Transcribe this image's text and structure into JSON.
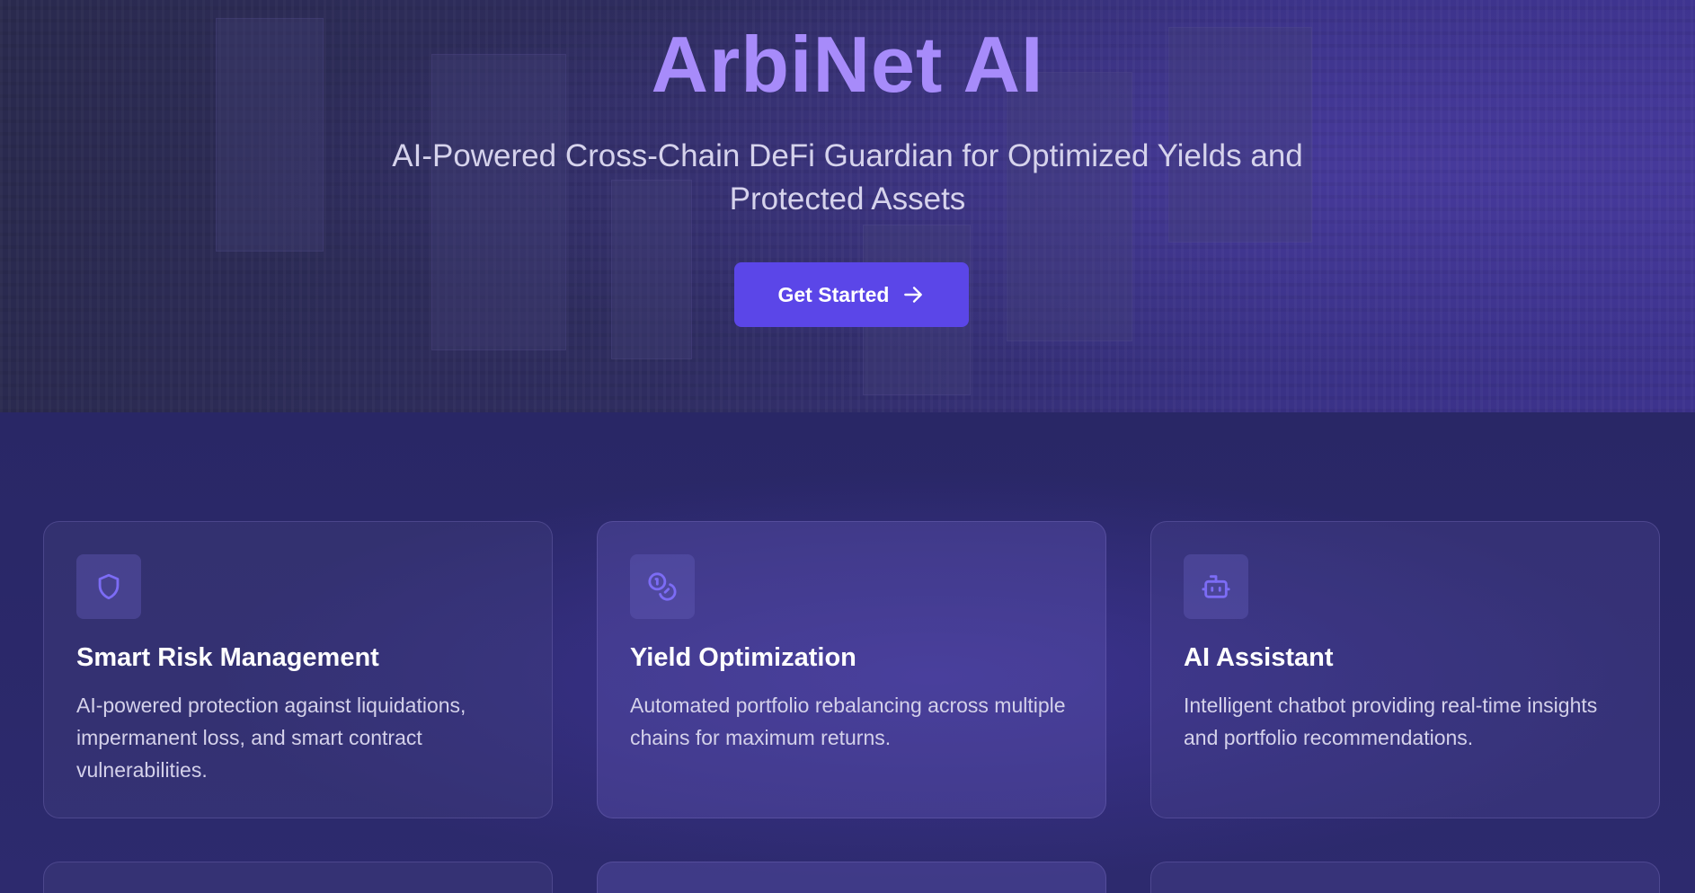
{
  "hero": {
    "title": "ArbiNet AI",
    "subtitle": "AI-Powered Cross-Chain DeFi Guardian for Optimized Yields and Protected Assets",
    "cta_label": "Get Started",
    "cta_icon": "arrow-right-icon"
  },
  "features": [
    {
      "icon": "shield-icon",
      "title": "Smart Risk Management",
      "description": "AI-powered protection against liquidations, impermanent loss, and smart contract vulnerabilities."
    },
    {
      "icon": "coins-icon",
      "title": "Yield Optimization",
      "description": "Automated portfolio rebalancing across multiple chains for maximum returns."
    },
    {
      "icon": "bot-icon",
      "title": "AI Assistant",
      "description": "Intelligent chatbot providing real-time insights and portfolio recommendations."
    }
  ],
  "colors": {
    "accent": "#a78bfa",
    "button": "#5b46e8",
    "icon": "#7c6cf5",
    "background": "#2b2868"
  }
}
